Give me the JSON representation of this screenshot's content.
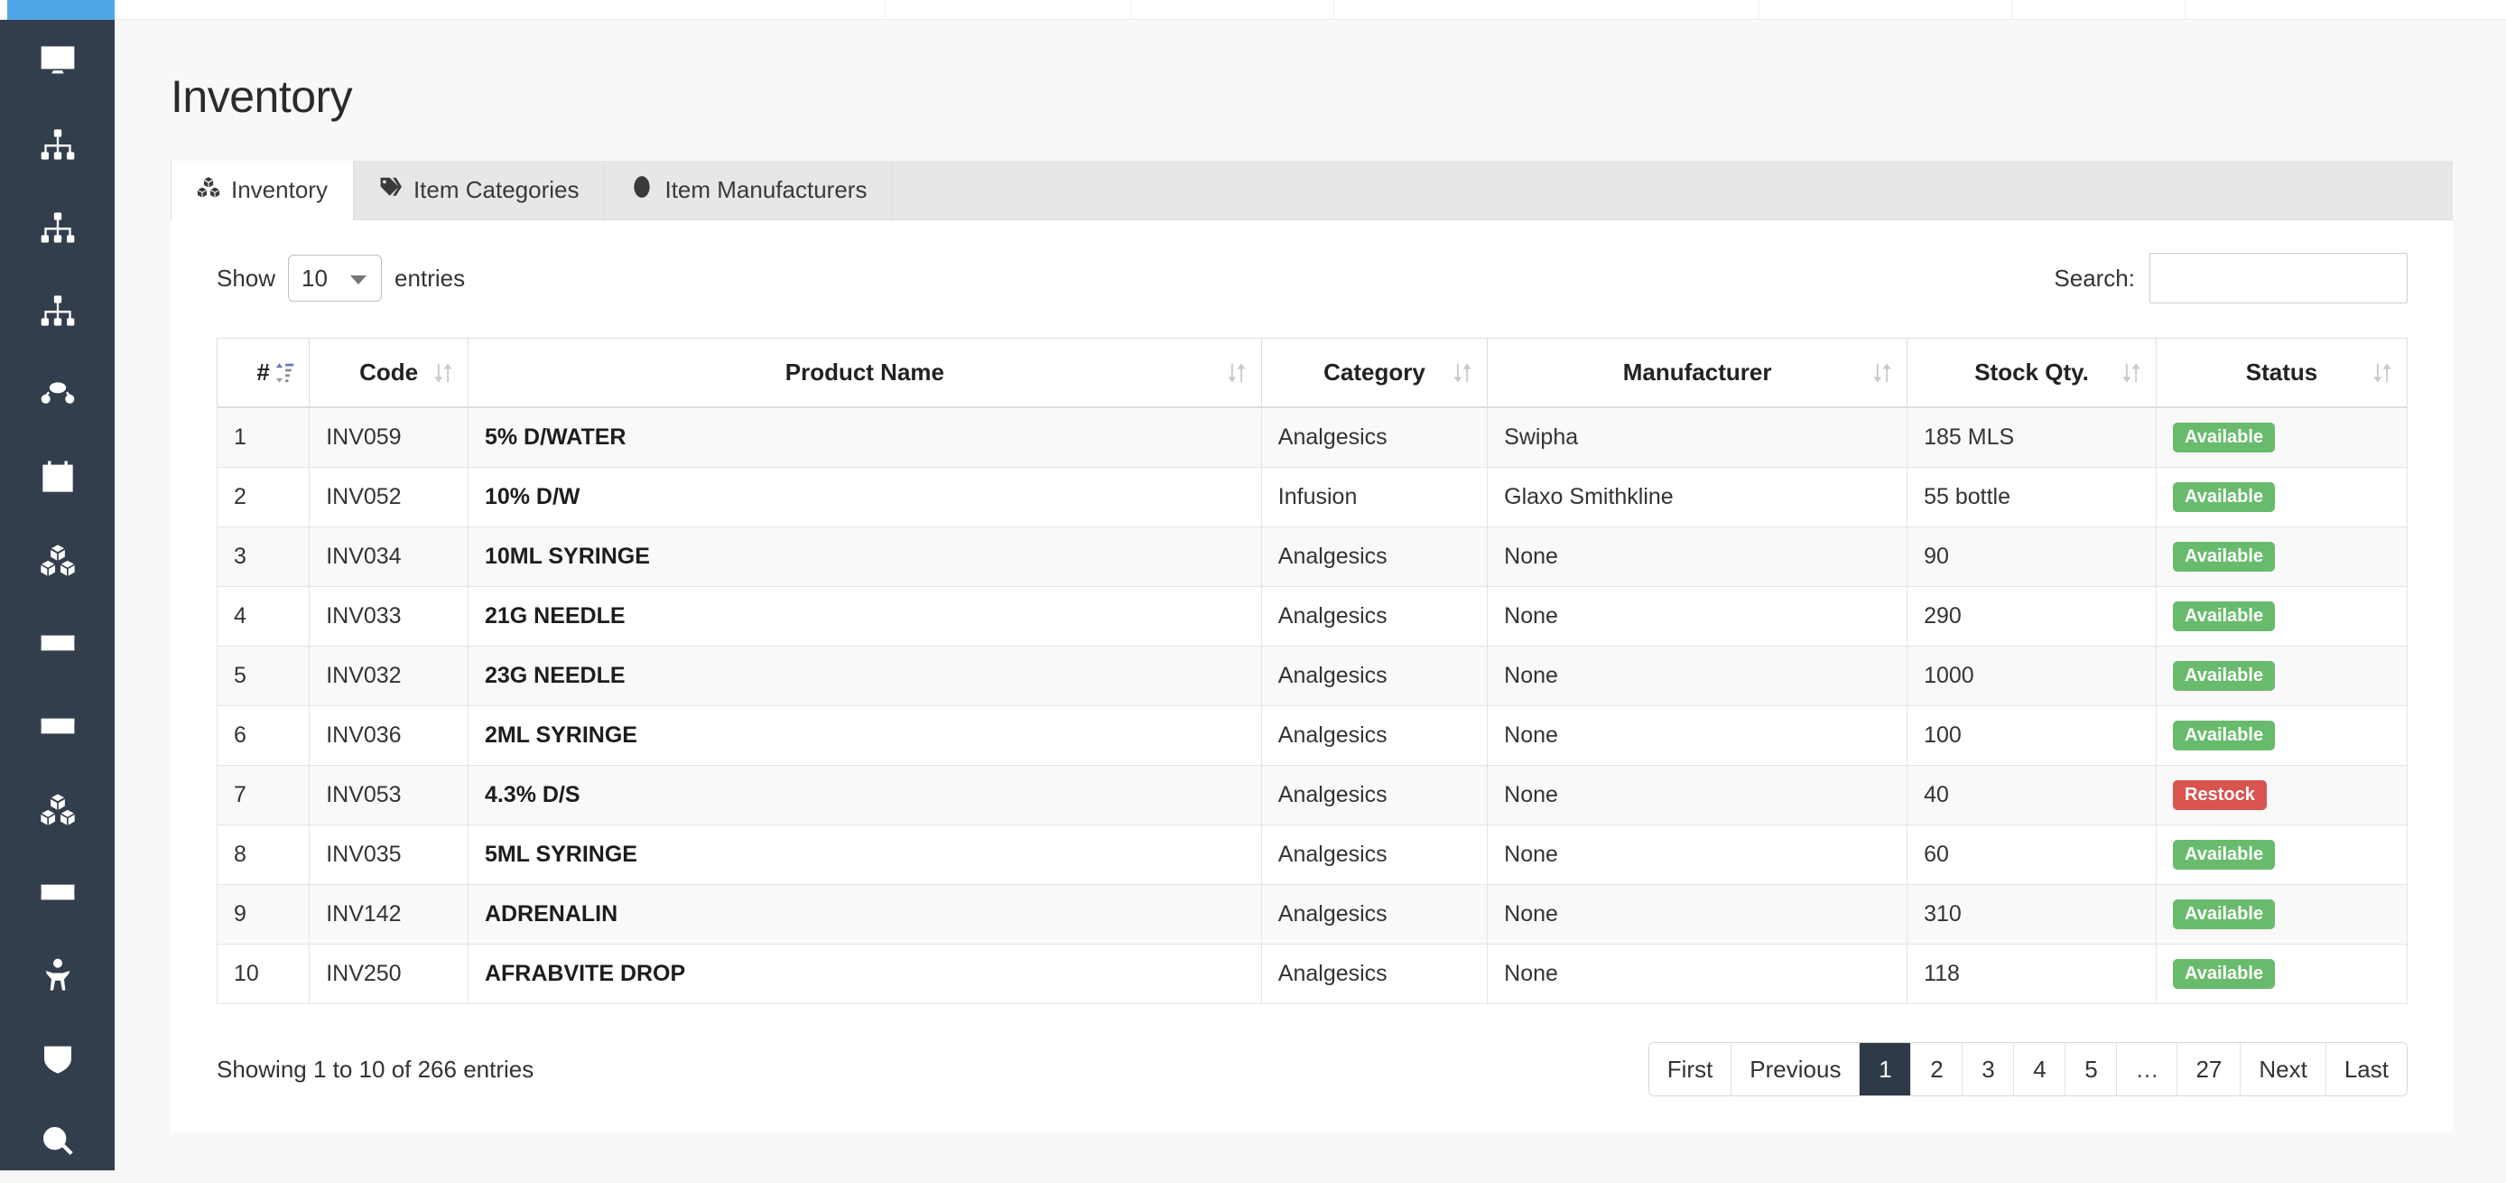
{
  "topbar": {
    "logo_color": "#4fa6e8"
  },
  "sidebar": {
    "background": "#333e4c",
    "items": [
      {
        "icon": "desktop-icon"
      },
      {
        "icon": "sitemap-icon"
      },
      {
        "icon": "sitemap-icon"
      },
      {
        "icon": "sitemap-icon"
      },
      {
        "icon": "users-group-icon"
      },
      {
        "icon": "calendar-icon"
      },
      {
        "icon": "cubes-icon"
      },
      {
        "icon": "money-bill-icon"
      },
      {
        "icon": "money-bill-icon"
      },
      {
        "icon": "cubes-icon"
      },
      {
        "icon": "money-bill-icon"
      },
      {
        "icon": "child-icon"
      },
      {
        "icon": "shield-icon"
      },
      {
        "icon": "search-icon"
      }
    ]
  },
  "page": {
    "title": "Inventory"
  },
  "tabs": [
    {
      "label": "Inventory",
      "icon": "cubes-icon",
      "active": true
    },
    {
      "label": "Item Categories",
      "icon": "tag-icon",
      "active": false
    },
    {
      "label": "Item Manufacturers",
      "icon": "life-ring-icon",
      "active": false
    }
  ],
  "controls": {
    "show_label": "Show",
    "entries_label": "entries",
    "page_length": "10",
    "search_label": "Search:",
    "search_value": "",
    "search_placeholder": ""
  },
  "table": {
    "columns": [
      {
        "label": "#",
        "sort": "asc-active"
      },
      {
        "label": "Code",
        "sort": "none"
      },
      {
        "label": "Product Name",
        "sort": "none"
      },
      {
        "label": "Category",
        "sort": "none"
      },
      {
        "label": "Manufacturer",
        "sort": "none"
      },
      {
        "label": "Stock Qty.",
        "sort": "none"
      },
      {
        "label": "Status",
        "sort": "none"
      }
    ],
    "rows": [
      {
        "idx": "1",
        "code": "INV059",
        "name": "5% D/WATER",
        "category": "Analgesics",
        "manufacturer": "Swipha",
        "qty": "185 MLS",
        "status": "Available",
        "status_type": "ok"
      },
      {
        "idx": "2",
        "code": "INV052",
        "name": "10% D/W",
        "category": "Infusion",
        "manufacturer": "Glaxo Smithkline",
        "qty": "55 bottle",
        "status": "Available",
        "status_type": "ok"
      },
      {
        "idx": "3",
        "code": "INV034",
        "name": "10ML SYRINGE",
        "category": "Analgesics",
        "manufacturer": "None",
        "qty": "90",
        "status": "Available",
        "status_type": "ok"
      },
      {
        "idx": "4",
        "code": "INV033",
        "name": "21G NEEDLE",
        "category": "Analgesics",
        "manufacturer": "None",
        "qty": "290",
        "status": "Available",
        "status_type": "ok"
      },
      {
        "idx": "5",
        "code": "INV032",
        "name": "23G NEEDLE",
        "category": "Analgesics",
        "manufacturer": "None",
        "qty": "1000",
        "status": "Available",
        "status_type": "ok"
      },
      {
        "idx": "6",
        "code": "INV036",
        "name": "2ML SYRINGE",
        "category": "Analgesics",
        "manufacturer": "None",
        "qty": "100",
        "status": "Available",
        "status_type": "ok"
      },
      {
        "idx": "7",
        "code": "INV053",
        "name": "4.3% D/S",
        "category": "Analgesics",
        "manufacturer": "None",
        "qty": "40",
        "status": "Restock",
        "status_type": "bad"
      },
      {
        "idx": "8",
        "code": "INV035",
        "name": "5ML SYRINGE",
        "category": "Analgesics",
        "manufacturer": "None",
        "qty": "60",
        "status": "Available",
        "status_type": "ok"
      },
      {
        "idx": "9",
        "code": "INV142",
        "name": "ADRENALIN",
        "category": "Analgesics",
        "manufacturer": "None",
        "qty": "310",
        "status": "Available",
        "status_type": "ok"
      },
      {
        "idx": "10",
        "code": "INV250",
        "name": "AFRABVITE DROP",
        "category": "Analgesics",
        "manufacturer": "None",
        "qty": "118",
        "status": "Available",
        "status_type": "ok"
      }
    ]
  },
  "footer": {
    "showing": "Showing 1 to 10 of 266 entries",
    "pagination": [
      {
        "label": "First",
        "active": false
      },
      {
        "label": "Previous",
        "active": false
      },
      {
        "label": "1",
        "active": true
      },
      {
        "label": "2",
        "active": false
      },
      {
        "label": "3",
        "active": false
      },
      {
        "label": "4",
        "active": false
      },
      {
        "label": "5",
        "active": false
      },
      {
        "label": "…",
        "active": false
      },
      {
        "label": "27",
        "active": false
      },
      {
        "label": "Next",
        "active": false
      },
      {
        "label": "Last",
        "active": false
      }
    ]
  },
  "colors": {
    "accent": "#4fa6e8",
    "sidebar": "#333e4c",
    "badge_ok": "#68bb6c",
    "badge_bad": "#d9534f",
    "pagination_active": "#2f3a48"
  }
}
